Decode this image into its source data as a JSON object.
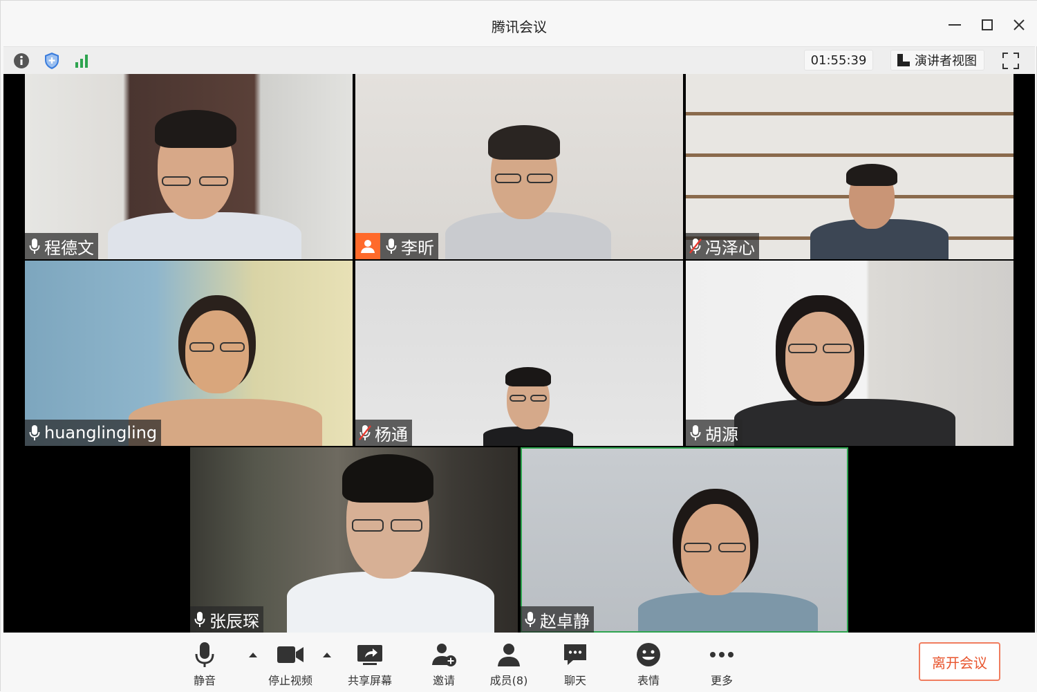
{
  "window": {
    "title": "腾讯会议"
  },
  "toolbar": {
    "timer": "01:55:39",
    "speaker_view_label": "演讲者视图"
  },
  "participants": [
    {
      "name": "程德文",
      "muted": false,
      "host": false
    },
    {
      "name": "李昕",
      "muted": false,
      "host": true
    },
    {
      "name": "冯泽心",
      "muted": true,
      "host": false
    },
    {
      "name": "huanglingling",
      "muted": false,
      "host": false
    },
    {
      "name": "杨通",
      "muted": true,
      "host": false
    },
    {
      "name": "胡源",
      "muted": false,
      "host": false
    },
    {
      "name": "张辰琛",
      "muted": false,
      "host": false
    },
    {
      "name": "赵卓静",
      "muted": false,
      "host": false,
      "speaking": true
    }
  ],
  "controls": {
    "mute": "静音",
    "stop_video": "停止视频",
    "share_screen": "共享屏幕",
    "invite": "邀请",
    "members": "成员(8)",
    "chat": "聊天",
    "reactions": "表情",
    "more": "更多",
    "leave": "离开会议"
  },
  "colors": {
    "accent_green": "#2ea44f",
    "host_badge": "#ff6a2b",
    "leave_border": "#f07c5e",
    "leave_text": "#e8552e",
    "shield_blue": "#3b7ddd"
  }
}
